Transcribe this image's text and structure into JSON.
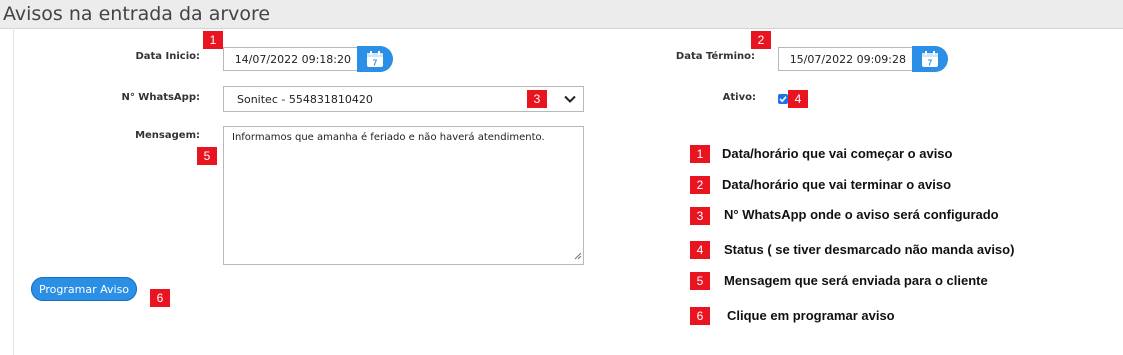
{
  "page": {
    "title": "Avisos na entrada da arvore"
  },
  "form": {
    "data_inicio_label": "Data Inicio:",
    "data_inicio_value": "14/07/2022 09:18:20",
    "data_termino_label": "Data Término:",
    "data_termino_value": "15/07/2022 09:09:28",
    "whatsapp_label": "N° WhatsApp:",
    "whatsapp_selected": "Sonitec - 554831810420",
    "ativo_label": "Ativo:",
    "ativo_checked": true,
    "mensagem_label": "Mensagem:",
    "mensagem_value": "Informamos que amanha é feriado e não haverá atendimento.",
    "submit_label": "Programar Aviso"
  },
  "markers": [
    "1",
    "2",
    "3",
    "4",
    "5",
    "6"
  ],
  "legend": [
    {
      "num": "1",
      "text": "Data/horário que vai começar o aviso"
    },
    {
      "num": "2",
      "text": "Data/horário que vai terminar o aviso"
    },
    {
      "num": "3",
      "text": "N° WhatsApp onde o aviso será configurado"
    },
    {
      "num": "4",
      "text": "Status ( se tiver desmarcado não manda aviso)"
    },
    {
      "num": "5",
      "text": "Mensagem que será enviada para o cliente"
    },
    {
      "num": "6",
      "text": "Clique em programar aviso"
    }
  ],
  "colors": {
    "accent": "#2b8fe6",
    "marker": "#e8141f"
  },
  "icons": {
    "calendar": "calendar-icon",
    "dropdown": "chevron-down-icon",
    "check": "checkmark-icon"
  }
}
